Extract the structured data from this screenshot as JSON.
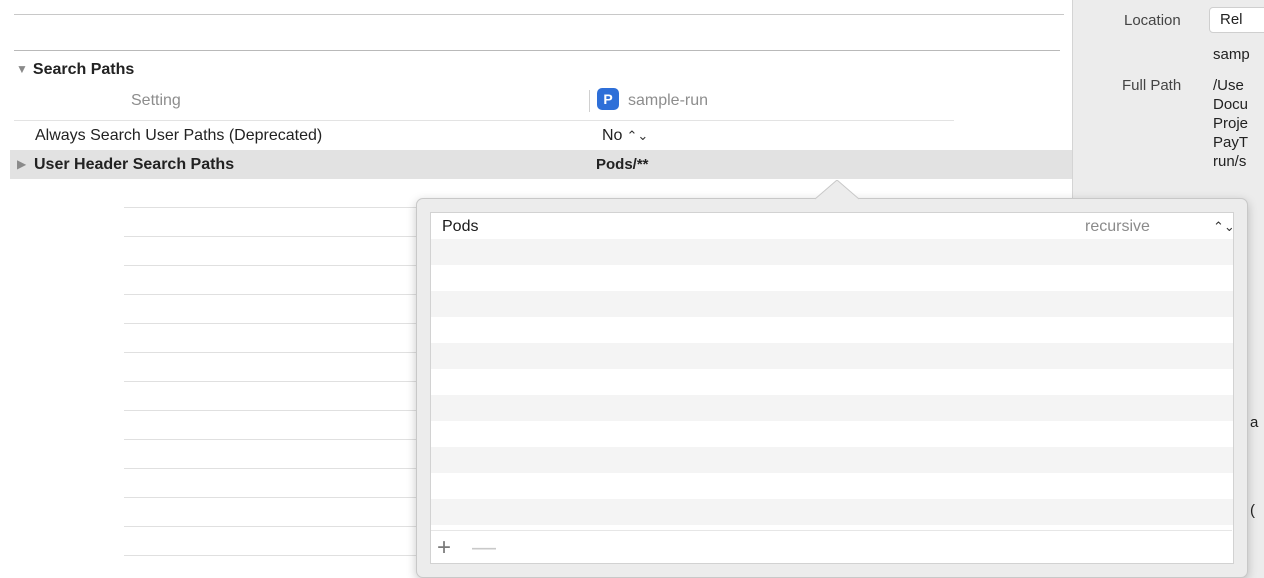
{
  "build_settings": {
    "section_title": "Search Paths",
    "section_disclosure": "▼",
    "columns": {
      "setting": "Setting",
      "target_name": "sample-run",
      "target_icon_letter": "P"
    },
    "rows": [
      {
        "label": "Always Search User Paths (Deprecated)",
        "value": "No",
        "stepper": "⌃⌄"
      },
      {
        "label": "User Header Search Paths",
        "value": "Pods/**",
        "disclosure": "▶"
      }
    ]
  },
  "popover": {
    "entries": [
      {
        "path": "Pods",
        "mode": "recursive",
        "stepper": "⌃⌄"
      }
    ],
    "add_label": "+",
    "remove_label": "—"
  },
  "inspector": {
    "location_label": "Location",
    "location_value": "Rel",
    "location_sub": "samp",
    "full_path_label": "Full Path",
    "full_path_lines": [
      "/Use",
      "Docu",
      "Proje",
      "PayT",
      "run/s"
    ],
    "partial_chars": [
      "a",
      "("
    ]
  },
  "colors": {
    "accent_blue": "#2e6fd8",
    "selected_row": "#e2e2e2",
    "popover_bg": "#ececec"
  }
}
